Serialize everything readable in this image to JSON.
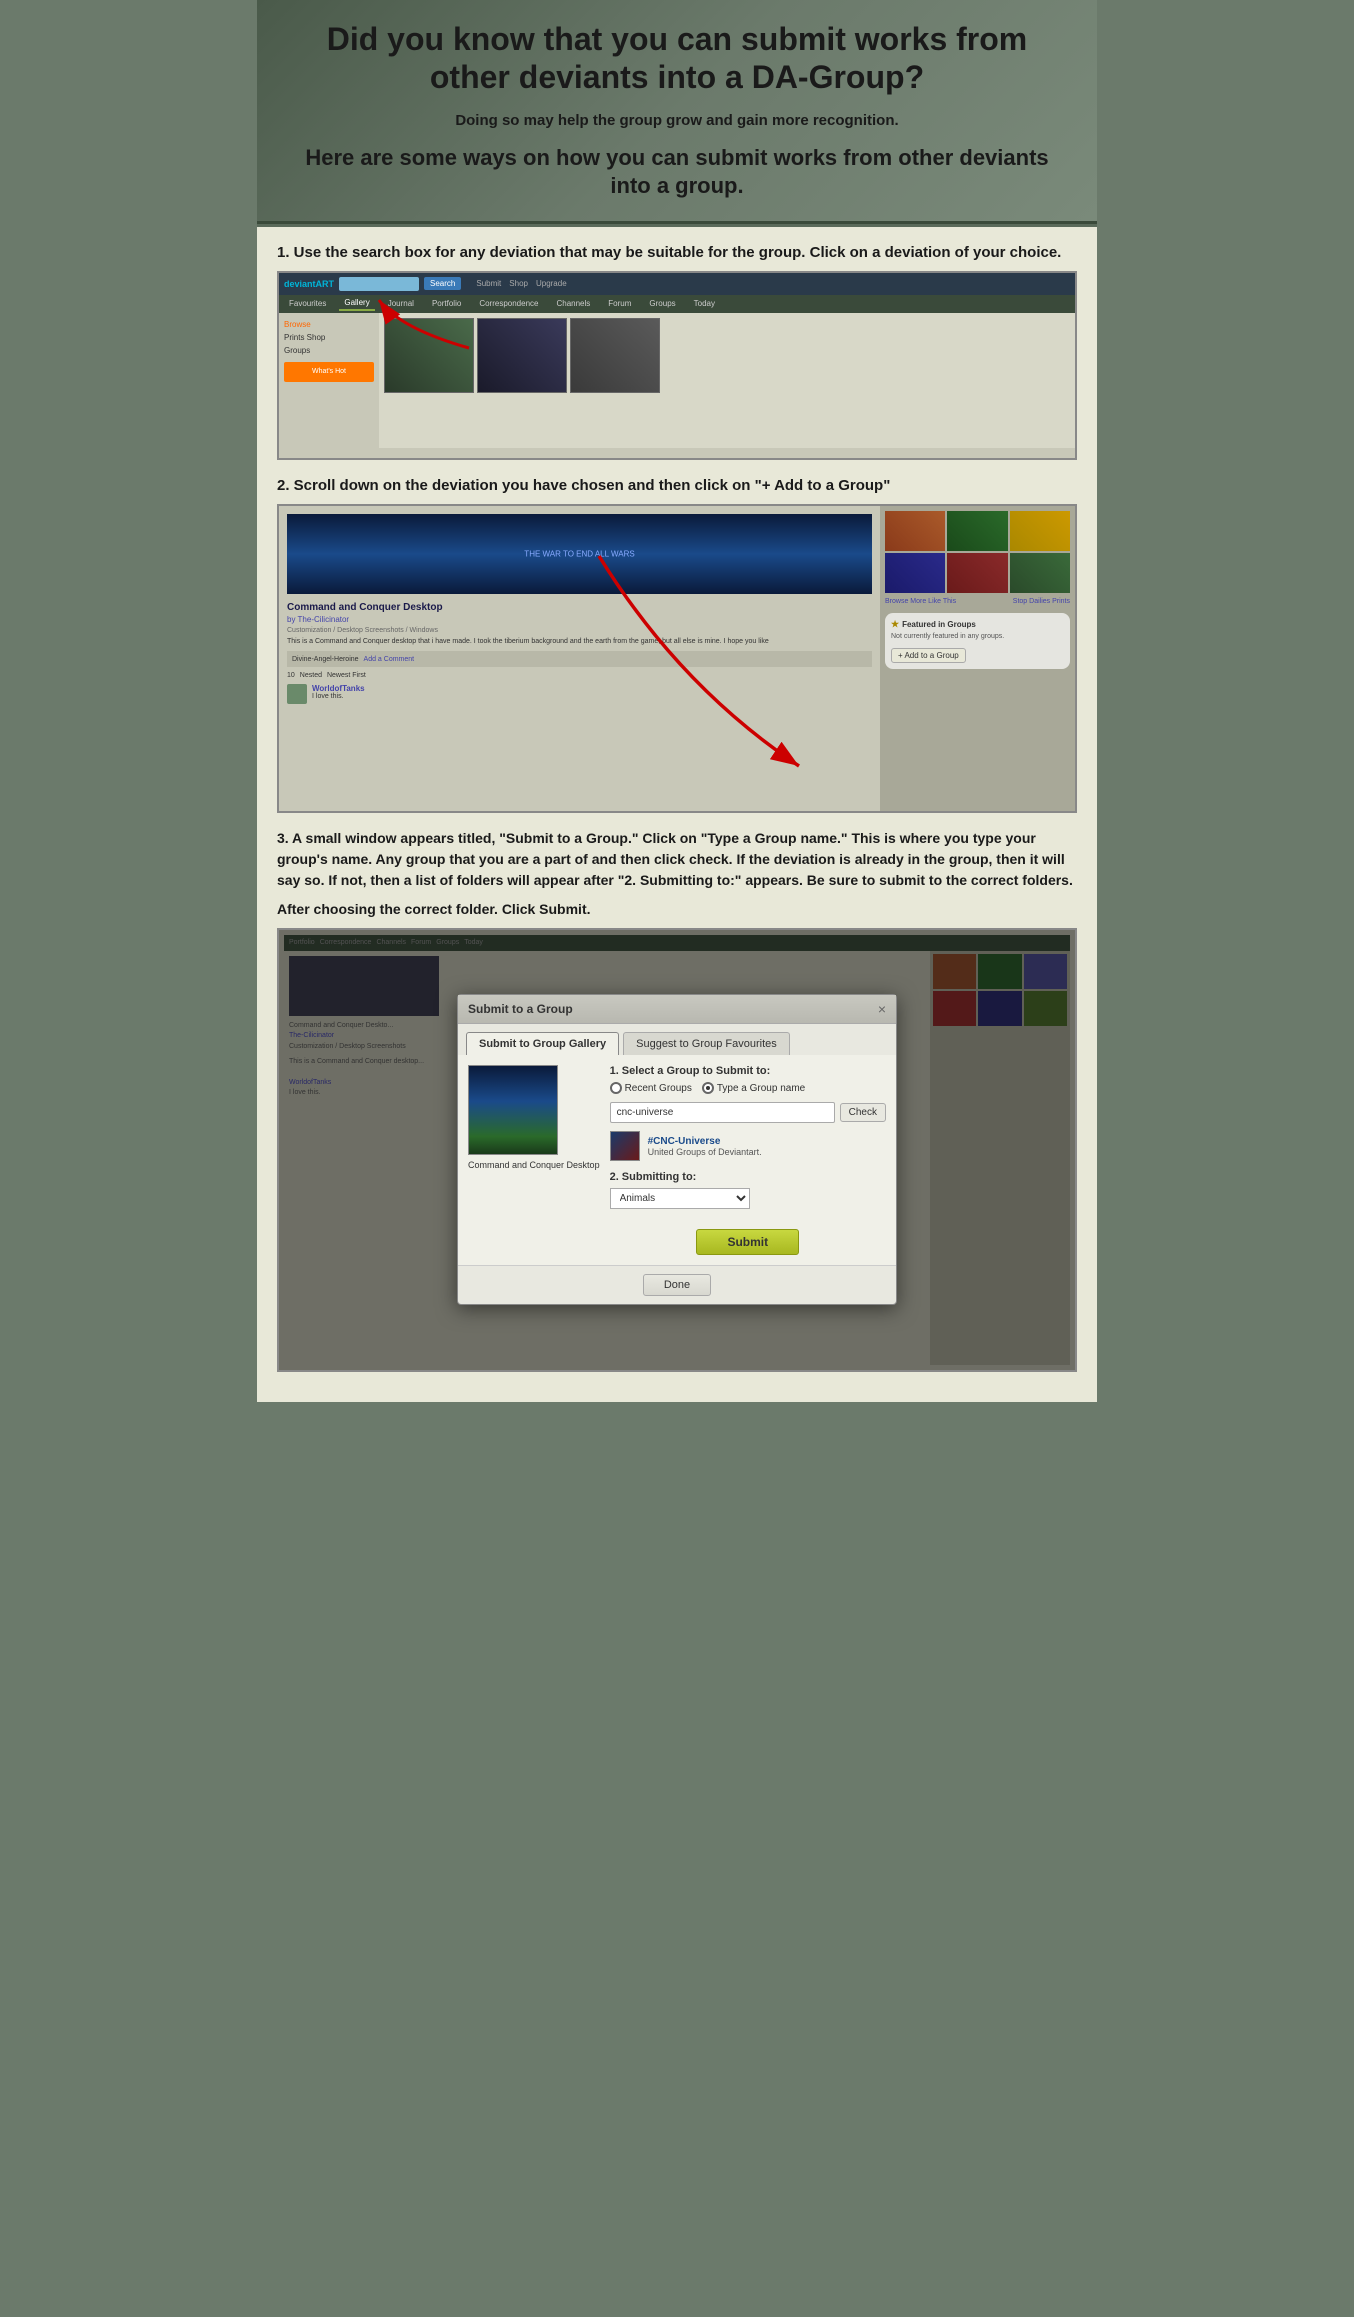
{
  "header": {
    "title": "Did you know that you can submit works from other deviants into a DA-Group?",
    "subtitle": "Doing so may help the group grow and gain more recognition.",
    "description": "Here are some ways on how you can submit works from other deviants into a group."
  },
  "step1": {
    "label": "1. Use the search box for any deviation that may be suitable for the group. Click on a deviation of your choice."
  },
  "step2": {
    "label": "2. Scroll down on the deviation you have chosen and  then click on \"+ Add to a Group\""
  },
  "step3": {
    "label": "3.  A small window appears titled, \"Submit to a Group.\" Click on \"Type a Group name.\" This is where you type your group's name. Any group that you are a part of and then click check. If the deviation is already in the group, then it will say so. If not, then a list of folders will appear after \"2. Submitting to:\" appears. Be sure to submit to the correct folders.",
    "after": "After choosing the correct folder. Click Submit."
  },
  "da_browse": {
    "logo": "deviantART",
    "search_placeholder": "Search",
    "search_button": "Search",
    "tabs": [
      "Favourites",
      "Gallery",
      "Journal",
      "Portfolio",
      "Correspondence",
      "Channels",
      "Forum",
      "Groups",
      "Today"
    ],
    "browse_title": "Browse",
    "sidebar_items": [
      "Prints Shop",
      "Groups"
    ],
    "active_sidebar": "Browse"
  },
  "da_deviation": {
    "image_text": "THE WAR TO END ALL WARS",
    "title": "Command and Conquer Desktop",
    "author": "by The-Cilicinator",
    "category": "Customization / Desktop Screenshots / Windows",
    "description": "This is a Command and Conquer desktop that i have made. I took the tiberium background and the earth from the game, but all else is mine. I hope you like",
    "add_comment_label": "Add a Comment",
    "comment_controls": {
      "count": "10",
      "sort": "Newest First",
      "nested_label": "Nested"
    },
    "commenter": "WorldofTanks",
    "comment_text": "I love this.",
    "featured_title": "Featured in Groups",
    "featured_text": "Not currently featured in any groups.",
    "add_to_group": "+ Add to a Group",
    "browse_more": "Browse More Like This",
    "stop_dailies": "Stop Dailies Prints"
  },
  "modal": {
    "title": "Submit to a Group",
    "close": "×",
    "tabs": {
      "submit_to_gallery": "Submit to Group Gallery",
      "suggest_to_favourites": "Suggest to Group Favourites"
    },
    "form": {
      "step1_label": "1. Select a Group to Submit to:",
      "radio_recent": "Recent Groups",
      "radio_type": "Type a Group name",
      "input_value": "cnc-universe",
      "check_button": "Check",
      "group_name": "#CNC-Universe",
      "group_subtitle": "United Groups of Deviantart.",
      "step2_label": "2. Submitting to:",
      "folder_selected": "Animals",
      "submit_button": "Submit",
      "done_button": "Done"
    },
    "image_label": "Command and Conquer Desktop"
  }
}
